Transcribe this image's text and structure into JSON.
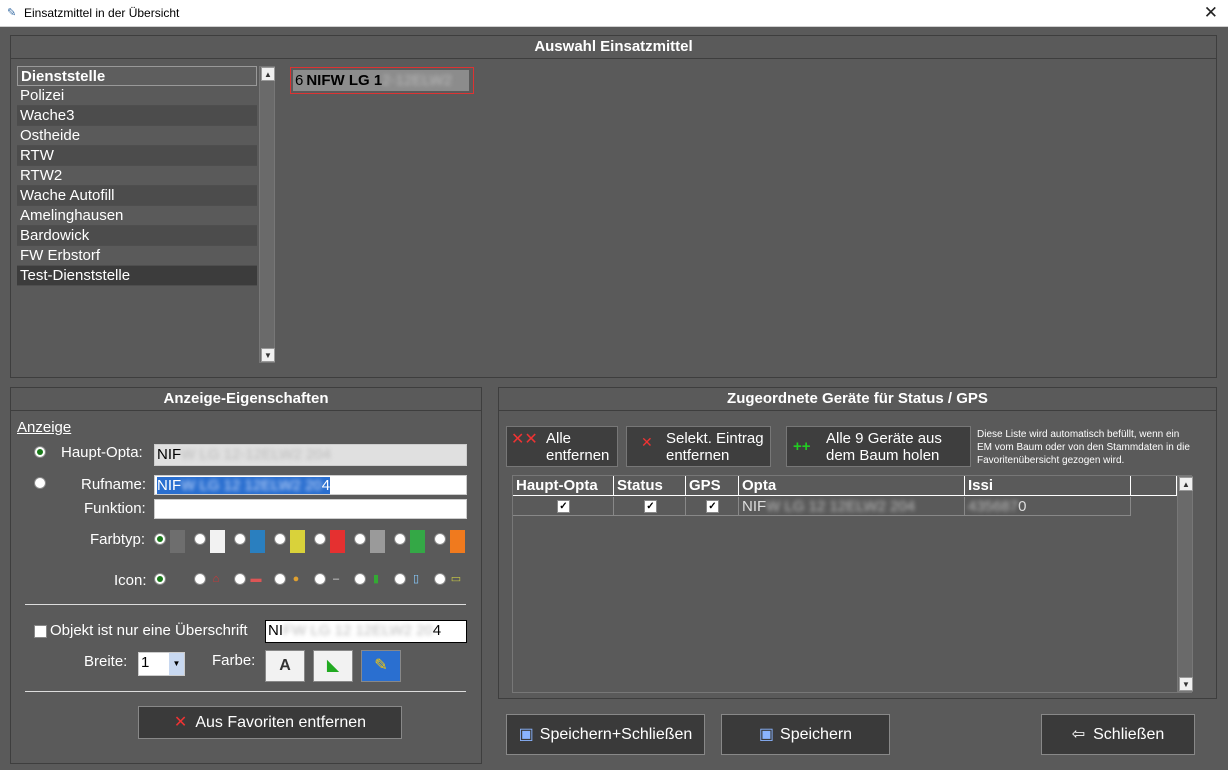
{
  "window": {
    "title": "Einsatzmittel in der Übersicht",
    "close": "✕"
  },
  "auswahl": {
    "title": "Auswahl Einsatzmittel",
    "list": [
      "Dienststelle",
      "Polizei",
      "Wache3",
      "Ostheide",
      "RTW",
      "RTW2",
      "Wache Autofill",
      "Amelinghausen",
      "Bardowick",
      "FW Erbstorf",
      "Test-Dienststelle"
    ],
    "chip_num": "6",
    "chip_text": "NIFW LG 1",
    "chip_blur": "2-12ELW2"
  },
  "anzeige": {
    "title": "Anzeige-Eigenschaften",
    "section": "Anzeige",
    "haupt_label": "Haupt-Opta:",
    "haupt_value": "NIF",
    "haupt_blur": "W LG 12-12ELW2  204",
    "rufname_label": "Rufname:",
    "rufname_value": "NIF",
    "rufname_blur": "W LG 12 12ELW2  20",
    "rufname_tail": "4",
    "funktion_label": "Funktion:",
    "farbtyp_label": "Farbtyp:",
    "icon_label": "Icon:",
    "ueberschrift_label": "Objekt ist nur eine Überschrift",
    "ueberschrift_value": "NI",
    "ueberschrift_blur": "FW LG 12 12ELW2  20",
    "ueberschrift_tail": "4",
    "breite_label": "Breite:",
    "breite_value": "1",
    "farbe_label": "Farbe:",
    "remove_fav_label": "Aus Favoriten entfernen",
    "swatch_colors": [
      "#6e6e6e",
      "#f2f2f2",
      "#2a7fbf",
      "#d9d23a",
      "#e53030",
      "#9a9a9a",
      "#34a846",
      "#f07a1e"
    ]
  },
  "geraete": {
    "title": "Zugeordnete Geräte für Status /  GPS",
    "btn_alle_line1": "Alle",
    "btn_alle_line2": "entfernen",
    "btn_selekt_line1": "Selekt. Eintrag",
    "btn_selekt_line2": "entfernen",
    "btn_holen_line1": "Alle 9 Geräte aus",
    "btn_holen_line2": "dem Baum holen",
    "note_l1": "Diese Liste wird automatisch befüllt, wenn ein",
    "note_l2": "EM vom Baum oder von den Stammdaten in die",
    "note_l3": "Favoritenübersicht gezogen wird.",
    "columns": [
      "Haupt-Opta",
      "Status",
      "GPS",
      "Opta",
      "Issi"
    ],
    "row_opta": "NIF",
    "row_opta_blur": "W LG 12 12ELW2  204",
    "row_issi_blur": "435687",
    "row_issi_tail": "0"
  },
  "actions": {
    "save_close": "Speichern+Schließen",
    "save": "Speichern",
    "close": "Schließen"
  }
}
